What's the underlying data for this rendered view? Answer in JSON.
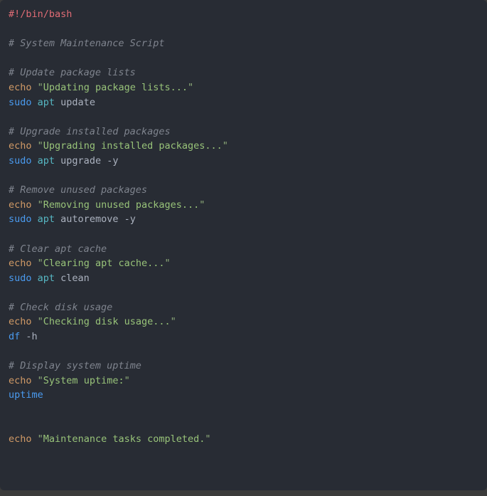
{
  "code_block": {
    "language": "bash",
    "background_color": "#282c34",
    "page_background_color": "#3b3b3b",
    "colors": {
      "shebang": "#e06c75",
      "comment": "#7f848e",
      "builtin": "#d19a66",
      "string": "#98c379",
      "quote": "#8fad7a",
      "keyword": "#4a9bf0",
      "command": "#56b6c2",
      "plain": "#abb2bf"
    },
    "lines": [
      {
        "tokens": [
          {
            "type": "shebang",
            "text": "#!/bin/bash"
          }
        ]
      },
      {
        "tokens": []
      },
      {
        "tokens": [
          {
            "type": "comment",
            "text": "# System Maintenance Script"
          }
        ]
      },
      {
        "tokens": []
      },
      {
        "tokens": [
          {
            "type": "comment",
            "text": "# Update package lists"
          }
        ]
      },
      {
        "tokens": [
          {
            "type": "builtin",
            "text": "echo"
          },
          {
            "type": "plain",
            "text": " "
          },
          {
            "type": "quote",
            "text": "\""
          },
          {
            "type": "string",
            "text": "Updating package lists..."
          },
          {
            "type": "quote",
            "text": "\""
          }
        ]
      },
      {
        "tokens": [
          {
            "type": "keyword",
            "text": "sudo"
          },
          {
            "type": "plain",
            "text": " "
          },
          {
            "type": "command",
            "text": "apt"
          },
          {
            "type": "plain",
            "text": " update"
          }
        ]
      },
      {
        "tokens": []
      },
      {
        "tokens": [
          {
            "type": "comment",
            "text": "# Upgrade installed packages"
          }
        ]
      },
      {
        "tokens": [
          {
            "type": "builtin",
            "text": "echo"
          },
          {
            "type": "plain",
            "text": " "
          },
          {
            "type": "quote",
            "text": "\""
          },
          {
            "type": "string",
            "text": "Upgrading installed packages..."
          },
          {
            "type": "quote",
            "text": "\""
          }
        ]
      },
      {
        "tokens": [
          {
            "type": "keyword",
            "text": "sudo"
          },
          {
            "type": "plain",
            "text": " "
          },
          {
            "type": "command",
            "text": "apt"
          },
          {
            "type": "plain",
            "text": " upgrade -y"
          }
        ]
      },
      {
        "tokens": []
      },
      {
        "tokens": [
          {
            "type": "comment",
            "text": "# Remove unused packages"
          }
        ]
      },
      {
        "tokens": [
          {
            "type": "builtin",
            "text": "echo"
          },
          {
            "type": "plain",
            "text": " "
          },
          {
            "type": "quote",
            "text": "\""
          },
          {
            "type": "string",
            "text": "Removing unused packages..."
          },
          {
            "type": "quote",
            "text": "\""
          }
        ]
      },
      {
        "tokens": [
          {
            "type": "keyword",
            "text": "sudo"
          },
          {
            "type": "plain",
            "text": " "
          },
          {
            "type": "command",
            "text": "apt"
          },
          {
            "type": "plain",
            "text": " autoremove -y"
          }
        ]
      },
      {
        "tokens": []
      },
      {
        "tokens": [
          {
            "type": "comment",
            "text": "# Clear apt cache"
          }
        ]
      },
      {
        "tokens": [
          {
            "type": "builtin",
            "text": "echo"
          },
          {
            "type": "plain",
            "text": " "
          },
          {
            "type": "quote",
            "text": "\""
          },
          {
            "type": "string",
            "text": "Clearing apt cache..."
          },
          {
            "type": "quote",
            "text": "\""
          }
        ]
      },
      {
        "tokens": [
          {
            "type": "keyword",
            "text": "sudo"
          },
          {
            "type": "plain",
            "text": " "
          },
          {
            "type": "command",
            "text": "apt"
          },
          {
            "type": "plain",
            "text": " clean"
          }
        ]
      },
      {
        "tokens": []
      },
      {
        "tokens": [
          {
            "type": "comment",
            "text": "# Check disk usage"
          }
        ]
      },
      {
        "tokens": [
          {
            "type": "builtin",
            "text": "echo"
          },
          {
            "type": "plain",
            "text": " "
          },
          {
            "type": "quote",
            "text": "\""
          },
          {
            "type": "string",
            "text": "Checking disk usage..."
          },
          {
            "type": "quote",
            "text": "\""
          }
        ]
      },
      {
        "tokens": [
          {
            "type": "keyword",
            "text": "df"
          },
          {
            "type": "plain",
            "text": " -h"
          }
        ]
      },
      {
        "tokens": []
      },
      {
        "tokens": [
          {
            "type": "comment",
            "text": "# Display system uptime"
          }
        ]
      },
      {
        "tokens": [
          {
            "type": "builtin",
            "text": "echo"
          },
          {
            "type": "plain",
            "text": " "
          },
          {
            "type": "quote",
            "text": "\""
          },
          {
            "type": "string",
            "text": "System uptime:"
          },
          {
            "type": "quote",
            "text": "\""
          }
        ]
      },
      {
        "tokens": [
          {
            "type": "keyword",
            "text": "uptime"
          }
        ]
      },
      {
        "tokens": []
      },
      {
        "tokens": []
      },
      {
        "tokens": [
          {
            "type": "builtin",
            "text": "echo"
          },
          {
            "type": "plain",
            "text": " "
          },
          {
            "type": "quote",
            "text": "\""
          },
          {
            "type": "string",
            "text": "Maintenance tasks completed."
          },
          {
            "type": "quote",
            "text": "\""
          }
        ]
      }
    ],
    "plain_text": "#!/bin/bash\n\n# System Maintenance Script\n\n# Update package lists\necho \"Updating package lists...\"\nsudo apt update\n\n# Upgrade installed packages\necho \"Upgrading installed packages...\"\nsudo apt upgrade -y\n\n# Remove unused packages\necho \"Removing unused packages...\"\nsudo apt autoremove -y\n\n# Clear apt cache\necho \"Clearing apt cache...\"\nsudo apt clean\n\n# Check disk usage\necho \"Checking disk usage...\"\ndf -h\n\n# Display system uptime\necho \"System uptime:\"\nuptime\n\n\necho \"Maintenance tasks completed.\""
  }
}
